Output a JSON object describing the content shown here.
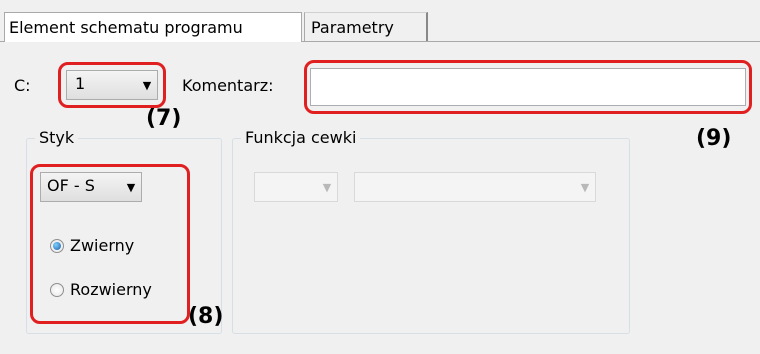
{
  "tabs": [
    {
      "label": "Element schematu programu",
      "active": true
    },
    {
      "label": "Parametry",
      "active": false
    }
  ],
  "fields": {
    "c_label": "C:",
    "c_value": "1",
    "komentarz_label": "Komentarz:",
    "komentarz_value": ""
  },
  "styk": {
    "title": "Styk",
    "type_value": "OF - S",
    "options": [
      {
        "label": "Zwierny",
        "checked": true
      },
      {
        "label": "Rozwierny",
        "checked": false
      }
    ]
  },
  "funkcja_cewki": {
    "title": "Funkcja cewki",
    "combo1_value": "",
    "combo2_value": ""
  },
  "annotations": {
    "a7": "(7)",
    "a8": "(8)",
    "a9": "(9)"
  },
  "colors": {
    "highlight": "#e02020",
    "background": "#f0f0f0"
  }
}
